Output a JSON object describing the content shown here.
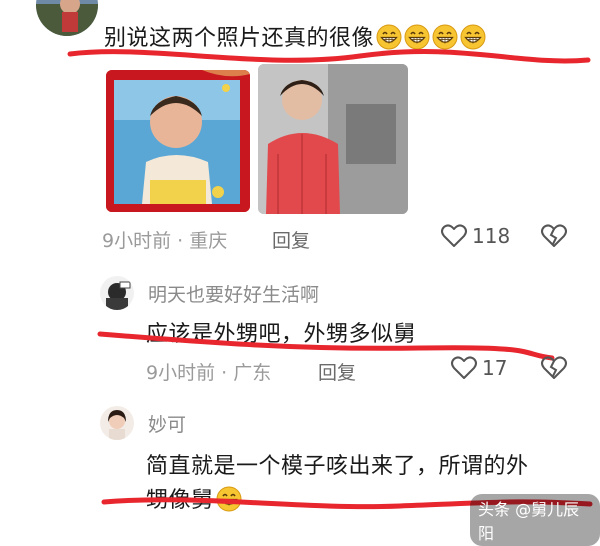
{
  "comments": [
    {
      "user": "",
      "text": "别说这两个照片还真的很像",
      "emoji_name": "grinning-face-emoji",
      "time": "9小时前",
      "location": "重庆",
      "reply_label": "回复",
      "like_count": "118"
    },
    {
      "user": "明天也要好好生活啊",
      "text": "应该是外甥吧，外甥多似舅",
      "time": "9小时前",
      "location": "广东",
      "reply_label": "回复",
      "like_count": "17"
    },
    {
      "user": "妙可",
      "text_line1": "简直就是一个模子咳出来了，所谓的外",
      "text_line2": "甥像舅",
      "emoji_name": "grinning-face-emoji"
    }
  ],
  "watermark": "头条 @舅儿辰阳",
  "colors": {
    "underline_red": "#e8262e",
    "meta_gray": "#9a9a9a",
    "photo_frame_red": "#c8171e"
  },
  "icons": {
    "like": "heart-outline-icon",
    "dislike": "broken-heart-icon"
  }
}
